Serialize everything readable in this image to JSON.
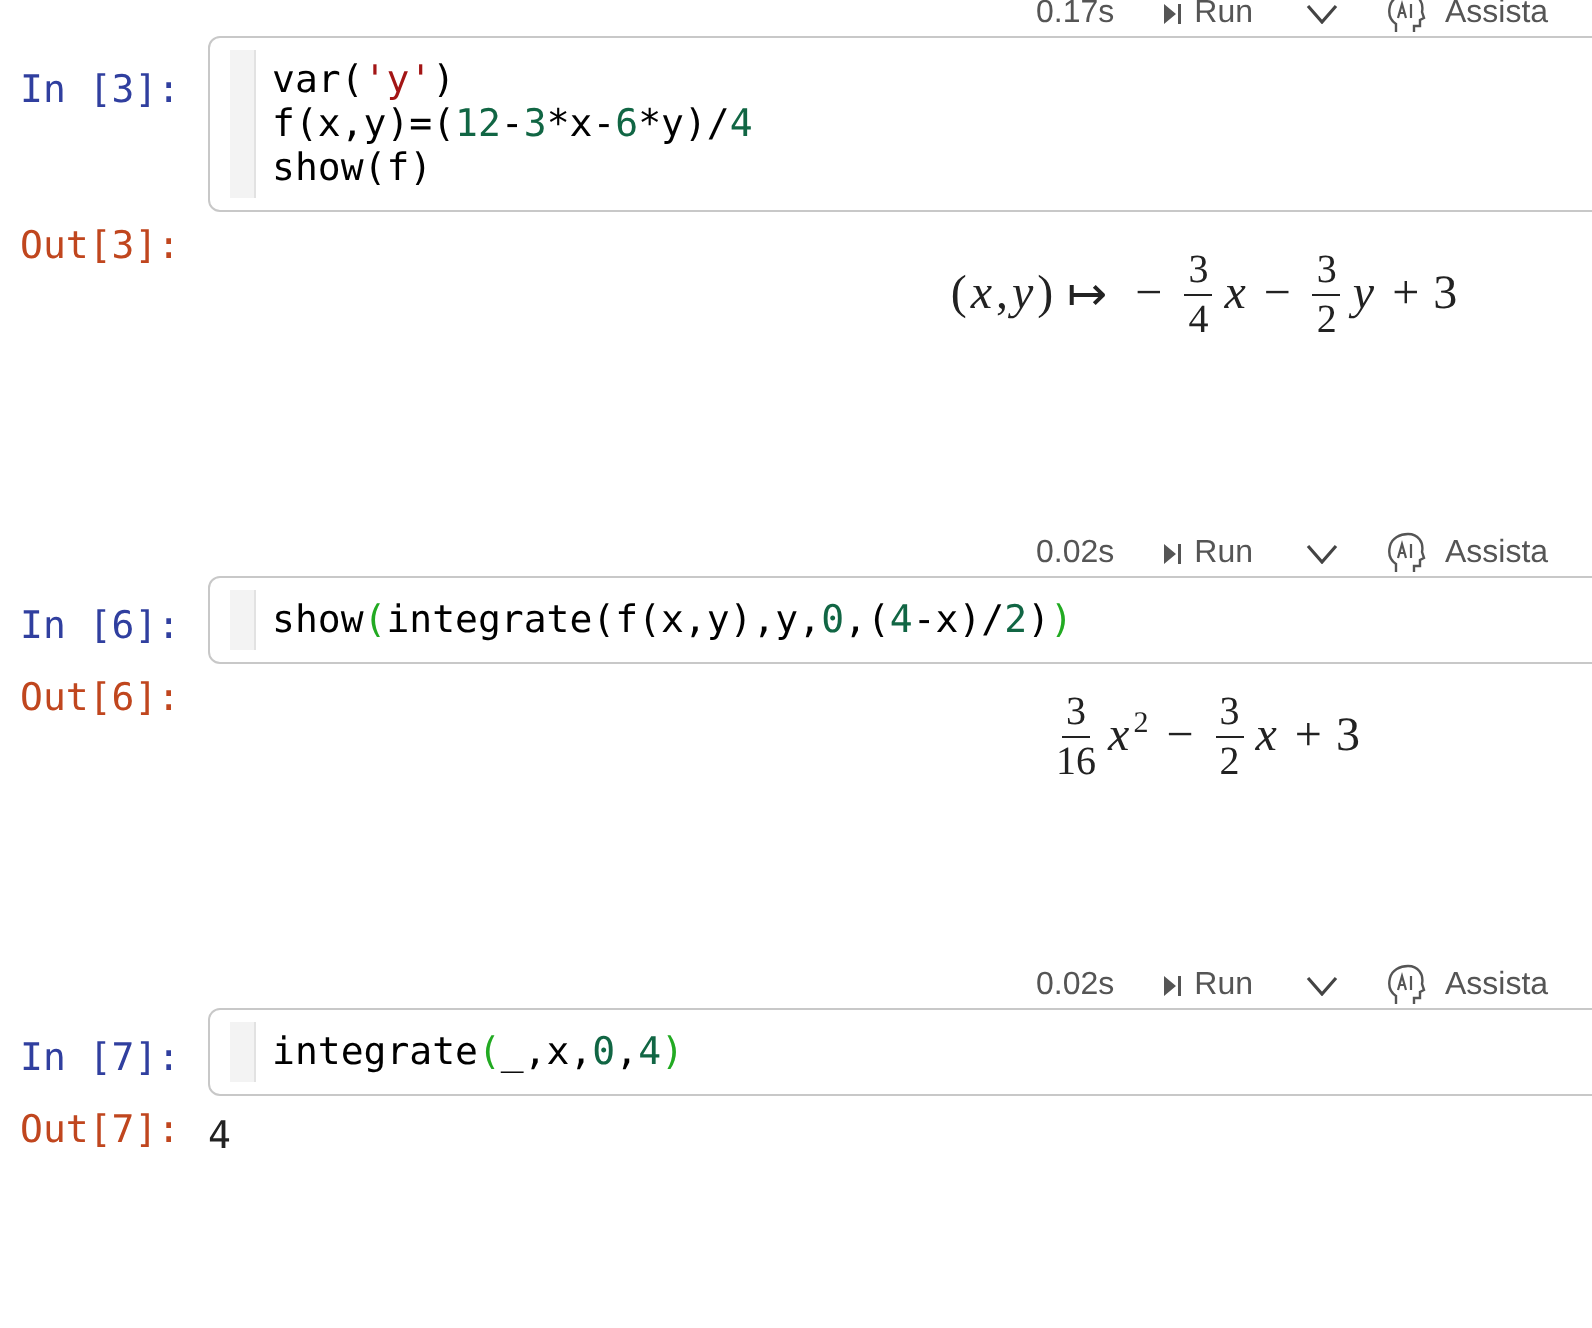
{
  "cells": [
    {
      "toolbar": {
        "time": "0.17s",
        "run": "Run",
        "assistant": "Assista"
      },
      "prompt_in": "In [3]:",
      "code": [
        [
          {
            "kind": "plain",
            "text": "var("
          },
          {
            "kind": "string",
            "text": "'y'"
          },
          {
            "kind": "plain",
            "text": ")"
          }
        ],
        [
          {
            "kind": "plain",
            "text": "f(x,y)=("
          },
          {
            "kind": "number",
            "text": "12"
          },
          {
            "kind": "plain",
            "text": "-"
          },
          {
            "kind": "number",
            "text": "3"
          },
          {
            "kind": "plain",
            "text": "*x-"
          },
          {
            "kind": "number",
            "text": "6"
          },
          {
            "kind": "plain",
            "text": "*y)/"
          },
          {
            "kind": "number",
            "text": "4"
          }
        ],
        [
          {
            "kind": "plain",
            "text": "show(f)"
          }
        ]
      ],
      "prompt_out": "Out[3]:",
      "output": {
        "kind": "math",
        "tokens": [
          {
            "kind": "sym",
            "text": "("
          },
          {
            "kind": "var",
            "text": "x"
          },
          {
            "kind": "sym",
            "text": ", "
          },
          {
            "kind": "var",
            "text": "y"
          },
          {
            "kind": "sym",
            "text": ")"
          },
          {
            "kind": "op",
            "text": "↦"
          },
          {
            "kind": "op",
            "text": "−"
          },
          {
            "kind": "frac",
            "num": "3",
            "den": "4"
          },
          {
            "kind": "var",
            "text": "x"
          },
          {
            "kind": "op",
            "text": "−"
          },
          {
            "kind": "frac",
            "num": "3",
            "den": "2"
          },
          {
            "kind": "var",
            "text": "y"
          },
          {
            "kind": "op",
            "text": "+"
          },
          {
            "kind": "sym",
            "text": "3"
          }
        ]
      }
    },
    {
      "toolbar": {
        "time": "0.02s",
        "run": "Run",
        "assistant": "Assista"
      },
      "prompt_in": "In [6]:",
      "code": [
        [
          {
            "kind": "plain",
            "text": "show"
          },
          {
            "kind": "bracket",
            "text": "("
          },
          {
            "kind": "plain",
            "text": "integrate(f(x,y),y,"
          },
          {
            "kind": "number",
            "text": "0"
          },
          {
            "kind": "plain",
            "text": ",("
          },
          {
            "kind": "number",
            "text": "4"
          },
          {
            "kind": "plain",
            "text": "-x)/"
          },
          {
            "kind": "number",
            "text": "2"
          },
          {
            "kind": "plain",
            "text": ")"
          },
          {
            "kind": "bracket",
            "text": ")"
          }
        ]
      ],
      "prompt_out": "Out[6]:",
      "output": {
        "kind": "math",
        "tokens": [
          {
            "kind": "frac",
            "num": "3",
            "den": "16"
          },
          {
            "kind": "power",
            "base": "x",
            "exp": "2"
          },
          {
            "kind": "op",
            "text": "−"
          },
          {
            "kind": "frac",
            "num": "3",
            "den": "2"
          },
          {
            "kind": "var",
            "text": "x"
          },
          {
            "kind": "op",
            "text": "+"
          },
          {
            "kind": "sym",
            "text": "3"
          }
        ]
      }
    },
    {
      "toolbar": {
        "time": "0.02s",
        "run": "Run",
        "assistant": "Assista"
      },
      "prompt_in": "In [7]:",
      "code": [
        [
          {
            "kind": "plain",
            "text": "integrate"
          },
          {
            "kind": "bracket",
            "text": "("
          },
          {
            "kind": "plain",
            "text": "_,x,"
          },
          {
            "kind": "number",
            "text": "0"
          },
          {
            "kind": "plain",
            "text": ","
          },
          {
            "kind": "number",
            "text": "4"
          },
          {
            "kind": "bracket",
            "text": ")"
          }
        ]
      ],
      "prompt_out": "Out[7]:",
      "output": {
        "kind": "text",
        "text": "4"
      }
    }
  ]
}
